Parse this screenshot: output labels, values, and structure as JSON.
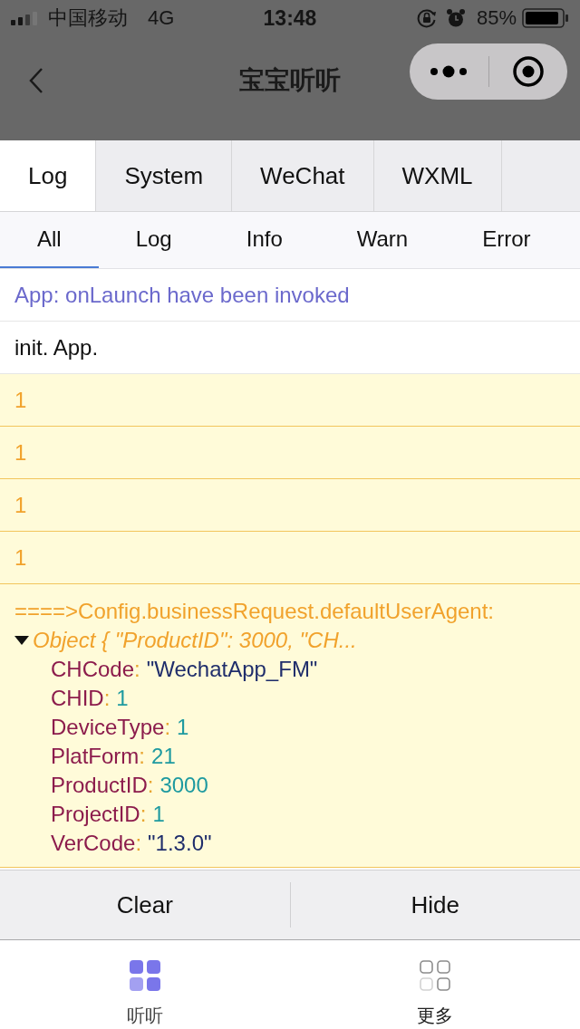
{
  "status_bar": {
    "carrier": "中国移动",
    "network": "4G",
    "time": "13:48",
    "battery": "85%"
  },
  "nav_bar": {
    "title": "宝宝听听"
  },
  "panel_tabs": [
    {
      "label": "Log",
      "selected": true
    },
    {
      "label": "System",
      "selected": false
    },
    {
      "label": "WeChat",
      "selected": false
    },
    {
      "label": "WXML",
      "selected": false
    }
  ],
  "filter_tabs": [
    {
      "label": "All",
      "selected": true
    },
    {
      "label": "Log",
      "selected": false
    },
    {
      "label": "Info",
      "selected": false
    },
    {
      "label": "Warn",
      "selected": false
    },
    {
      "label": "Error",
      "selected": false
    }
  ],
  "log_entries": [
    {
      "kind": "info",
      "text": "App: onLaunch have been invoked"
    },
    {
      "kind": "log",
      "text": "init. App."
    },
    {
      "kind": "warn",
      "text": "1"
    },
    {
      "kind": "warn",
      "text": "1"
    },
    {
      "kind": "warn",
      "text": "1"
    },
    {
      "kind": "warn",
      "text": "1"
    },
    {
      "kind": "warn",
      "text": "====>Config.businessRequest.defaultUserAgent:",
      "object": {
        "summary": "Object { \"ProductID\": 3000, \"CH...",
        "expanded": true,
        "properties": [
          {
            "key": "CHCode",
            "separator": ":",
            "value": "\"WechatApp_FM\"",
            "kind": "string"
          },
          {
            "key": "CHID",
            "separator": ":",
            "value": "1",
            "kind": "number"
          },
          {
            "key": "DeviceType",
            "separator": ":",
            "value": "1",
            "kind": "number"
          },
          {
            "key": "PlatForm",
            "separator": ":",
            "value": "21",
            "kind": "number"
          },
          {
            "key": "ProductID",
            "separator": ":",
            "value": "3000",
            "kind": "number"
          },
          {
            "key": "ProjectID",
            "separator": ":",
            "value": "1",
            "kind": "number"
          },
          {
            "key": "VerCode",
            "separator": ":",
            "value": "\"1.3.0\"",
            "kind": "string"
          }
        ]
      }
    }
  ],
  "action_buttons": [
    {
      "label": "Clear"
    },
    {
      "label": "Hide"
    }
  ],
  "tab_bar": [
    {
      "label": "听听",
      "selected": true
    },
    {
      "label": "更多",
      "selected": false
    }
  ]
}
